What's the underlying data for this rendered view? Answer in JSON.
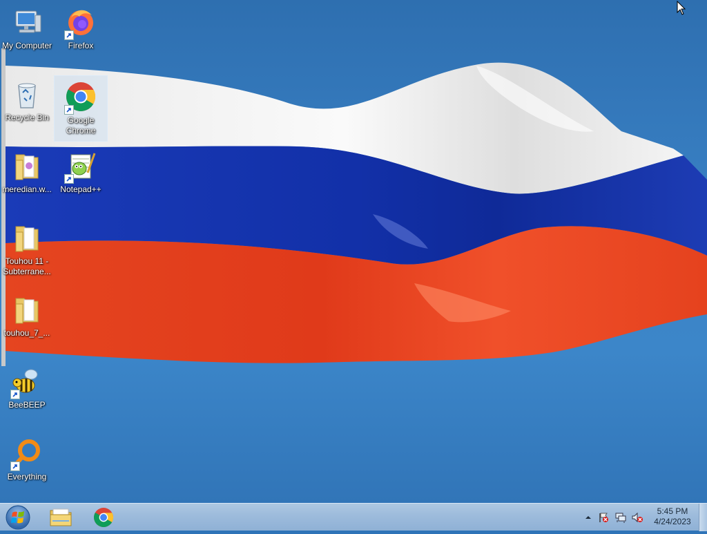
{
  "desktop": {
    "icons": [
      {
        "label": "My Computer",
        "icon": "computer-icon",
        "shortcut": false
      },
      {
        "label": "Firefox",
        "icon": "firefox-icon",
        "shortcut": true
      },
      {
        "label": "Recycle Bin",
        "icon": "recycle-bin-icon",
        "shortcut": false
      },
      {
        "label": "Google Chrome",
        "icon": "chrome-icon",
        "shortcut": true,
        "selected": true
      },
      {
        "label": "meredian.w...",
        "icon": "folder-icon",
        "shortcut": false
      },
      {
        "label": "Notepad++",
        "icon": "notepadpp-icon",
        "shortcut": true
      },
      {
        "label": "Touhou 11 - Subterrane...",
        "icon": "folder-icon",
        "shortcut": false
      },
      {
        "label": "touhou_7_...",
        "icon": "folder-icon",
        "shortcut": false
      },
      {
        "label": "BeeBEEP",
        "icon": "beebeep-icon",
        "shortcut": true
      },
      {
        "label": "Everything",
        "icon": "everything-icon",
        "shortcut": true
      }
    ],
    "wallpaper": "russian-flag-wallpaper"
  },
  "taskbar": {
    "start": "windows-start-icon",
    "pinned": [
      {
        "name": "file-explorer-icon"
      },
      {
        "name": "chrome-icon"
      }
    ],
    "tray": [
      "show-hidden-icons-icon",
      "action-center-flag-icon",
      "network-icon",
      "volume-muted-icon"
    ],
    "clock": {
      "time": "5:45 PM",
      "date": "4/24/2023"
    }
  },
  "colors": {
    "sky": "#3a82c6",
    "flag_white": "#f2f2f2",
    "flag_blue": "#1736b0",
    "flag_red": "#e8401c",
    "taskbar": "#9ebcdc"
  }
}
